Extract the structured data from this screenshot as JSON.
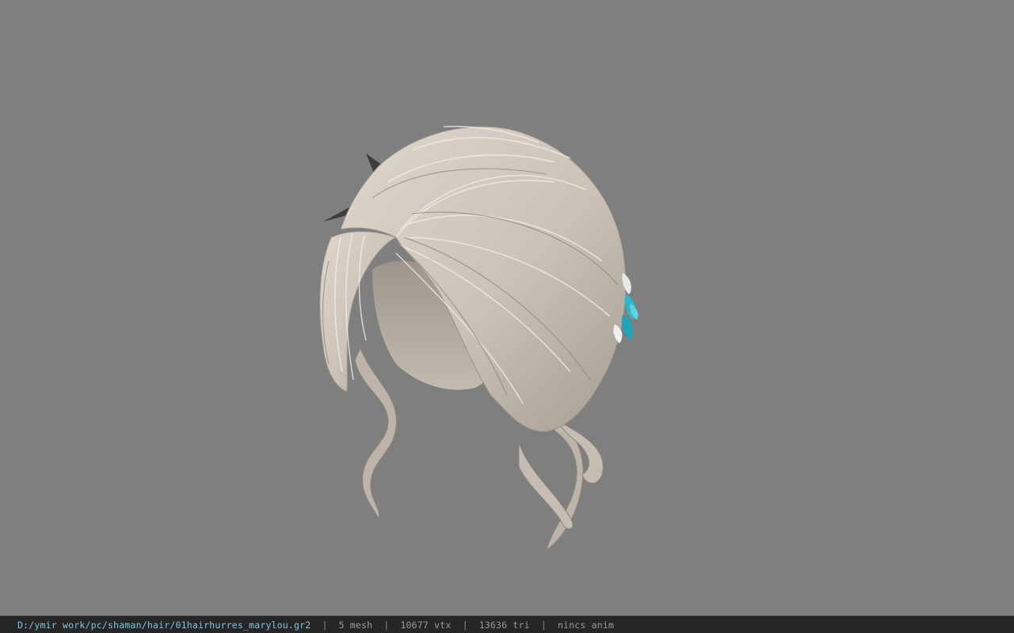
{
  "status_bar": {
    "file_path": "D:/ymir work/pc/shaman/hair/01hairhurres_marylou.gr2",
    "separator": "|",
    "mesh_count": "5 mesh",
    "vertex_count": "10677 vtx",
    "triangle_count": "13636 tri",
    "anim_status": "nincs anim"
  },
  "colors": {
    "viewport_background": "#7f7f7f",
    "status_bar_background": "#262626",
    "path_text": "#7fc6e0",
    "info_text": "#9a9a9a",
    "hair_base": "#cfc6bb",
    "hair_shadow": "#9c948b",
    "hair_accent": "#2bb7c9"
  }
}
